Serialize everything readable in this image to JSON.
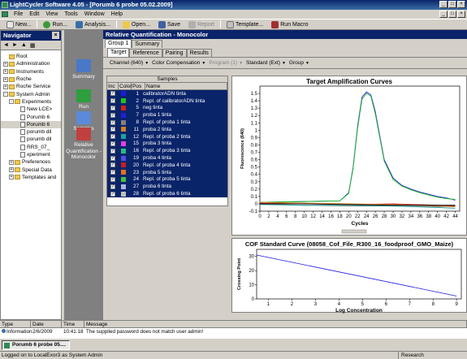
{
  "app": {
    "title": "LightCycler Software 4.05 - [Porumb 6 probe 05.02.2009]"
  },
  "menu": [
    "File",
    "Edit",
    "View",
    "Tools",
    "Window",
    "Help"
  ],
  "toolbar": {
    "new": "New...",
    "run": "Run...",
    "analysis": "Analysis...",
    "open": "Open...",
    "save": "Save",
    "report": "Report",
    "template": "Template...",
    "run_macro": "Run Macro"
  },
  "navigator": {
    "title": "Navigator",
    "items": [
      {
        "label": "Root",
        "level": 0,
        "type": "folder",
        "exp": ""
      },
      {
        "label": "Administration",
        "level": 0,
        "type": "folder",
        "exp": "+"
      },
      {
        "label": "Instruments",
        "level": 0,
        "type": "folder",
        "exp": "+"
      },
      {
        "label": "Roche",
        "level": 0,
        "type": "folder",
        "exp": "+"
      },
      {
        "label": "Roche Service",
        "level": 0,
        "type": "folder",
        "exp": "+"
      },
      {
        "label": "System Admin",
        "level": 0,
        "type": "folder",
        "exp": "-"
      },
      {
        "label": "Experiments",
        "level": 1,
        "type": "folder",
        "exp": "-"
      },
      {
        "label": "New LCE>",
        "level": 2,
        "type": "file",
        "exp": ""
      },
      {
        "label": "Porumb 6",
        "level": 2,
        "type": "file",
        "exp": ""
      },
      {
        "label": "Porumb 6",
        "level": 2,
        "type": "file",
        "exp": "",
        "selected": true
      },
      {
        "label": "porumb dil",
        "level": 2,
        "type": "file",
        "exp": ""
      },
      {
        "label": "porumb dil",
        "level": 2,
        "type": "file",
        "exp": ""
      },
      {
        "label": "RRS_07_",
        "level": 2,
        "type": "file",
        "exp": ""
      },
      {
        "label": "xperiment",
        "level": 2,
        "type": "file",
        "exp": ""
      },
      {
        "label": "Preferences",
        "level": 1,
        "type": "folder",
        "exp": "+"
      },
      {
        "label": "Special Data",
        "level": 1,
        "type": "folder",
        "exp": "+"
      },
      {
        "label": "Templates and",
        "level": 1,
        "type": "folder",
        "exp": "+"
      }
    ]
  },
  "shortcuts": [
    {
      "label": "Summary",
      "lines": [
        "Summary"
      ],
      "color": "#4a78c8"
    },
    {
      "label": "Run",
      "lines": [
        "Run"
      ],
      "color": "#2e9e3e"
    },
    {
      "label": "Samples",
      "lines": [
        "Samples"
      ],
      "color": "#5a8ad8"
    },
    {
      "label": "Relative Quantification - Monocolor",
      "lines": [
        "Relative",
        "Quantification -",
        "Monocolor"
      ],
      "color": "#c04040"
    }
  ],
  "module": {
    "title": "Relative Quantification - Monocolor"
  },
  "tabs1": [
    "Group 1",
    "Summary"
  ],
  "tabs2": [
    "Target",
    "Reference",
    "Pairing",
    "Results"
  ],
  "options": [
    {
      "label": "Channel (640)",
      "disabled": false
    },
    {
      "label": "Color Compensation",
      "disabled": false
    },
    {
      "label": "Program (1)",
      "disabled": true
    },
    {
      "label": "Standard (Ext)",
      "disabled": false
    },
    {
      "label": "Group",
      "disabled": false
    }
  ],
  "samples": {
    "header": "Samples",
    "columns": [
      "Inc",
      "Color",
      "Pos",
      "Name"
    ],
    "rows": [
      {
        "pos": "1",
        "name": "calibratorADN tinta",
        "color": "#1a1ae0"
      },
      {
        "pos": "2",
        "name": "Repl. of calibratorADN tinta",
        "color": "#20c020"
      },
      {
        "pos": "5",
        "name": "neg tinta",
        "color": "#d02020"
      },
      {
        "pos": "7",
        "name": "proba 1 tinta",
        "color": "#2020d0"
      },
      {
        "pos": "8",
        "name": "Repl. of proba 1 tinta",
        "color": "#808080"
      },
      {
        "pos": "11",
        "name": "proba 2 tinta",
        "color": "#d08020"
      },
      {
        "pos": "12",
        "name": "Repl. of proba 2 tinta",
        "color": "#20a0a0"
      },
      {
        "pos": "15",
        "name": "proba 3 tinta",
        "color": "#e040e0"
      },
      {
        "pos": "16",
        "name": "Repl. of proba 3 tinta",
        "color": "#20c080"
      },
      {
        "pos": "19",
        "name": "proba 4 tinta",
        "color": "#5050e0"
      },
      {
        "pos": "20",
        "name": "Repl. of proba 4 tinta",
        "color": "#c02020"
      },
      {
        "pos": "23",
        "name": "proba 5 tinta",
        "color": "#e07020"
      },
      {
        "pos": "24",
        "name": "Repl. of proba 5 tinta",
        "color": "#40c040"
      },
      {
        "pos": "27",
        "name": "proba 6 tinta",
        "color": "#b0b0e0"
      },
      {
        "pos": "28",
        "name": "Repl. of proba 6 tinta",
        "color": "#c0c0c0"
      }
    ]
  },
  "chart_data": [
    {
      "type": "line",
      "title": "Target Amplification Curves",
      "xlabel": "Cycles",
      "ylabel": "Fluorescence (640)",
      "xlim": [
        0,
        45
      ],
      "ylim": [
        -0.1,
        1.6
      ],
      "xticks": [
        0,
        2,
        4,
        6,
        8,
        10,
        12,
        14,
        16,
        18,
        20,
        22,
        24,
        26,
        28,
        30,
        32,
        34,
        36,
        38,
        40,
        42,
        44
      ],
      "yticks": [
        -0.1,
        0,
        0.1,
        0.2,
        0.3,
        0.4,
        0.5,
        0.6,
        0.7,
        0.8,
        0.9,
        1,
        1.1,
        1.2,
        1.3,
        1.4,
        1.5
      ],
      "series": [
        {
          "color": "#1a1ae0",
          "x": [
            0,
            18,
            20,
            21,
            22,
            23,
            24,
            25,
            26,
            28,
            30,
            32,
            34,
            36,
            38,
            40,
            42,
            44
          ],
          "y": [
            0.02,
            0.04,
            0.15,
            0.5,
            1.05,
            1.45,
            1.52,
            1.48,
            1.25,
            0.6,
            0.35,
            0.25,
            0.2,
            0.16,
            0.13,
            0.1,
            0.08,
            0.05
          ]
        },
        {
          "color": "#20c020",
          "x": [
            0,
            18,
            20,
            21,
            22,
            23,
            24,
            25,
            26,
            28,
            30,
            32,
            34,
            36,
            38,
            40,
            42,
            44
          ],
          "y": [
            0.02,
            0.04,
            0.14,
            0.48,
            1.02,
            1.42,
            1.5,
            1.46,
            1.22,
            0.58,
            0.33,
            0.24,
            0.19,
            0.15,
            0.12,
            0.09,
            0.07,
            0.06
          ]
        },
        {
          "color": "#808080",
          "x": [
            0,
            10,
            20,
            30,
            40,
            44
          ],
          "y": [
            0.0,
            -0.02,
            -0.03,
            -0.03,
            -0.04,
            -0.03
          ]
        },
        {
          "color": "#d02020",
          "x": [
            0,
            10,
            20,
            30,
            40,
            44
          ],
          "y": [
            0.01,
            0.0,
            -0.01,
            0.0,
            -0.02,
            -0.03
          ]
        },
        {
          "color": "#d08020",
          "x": [
            0,
            10,
            20,
            30,
            40,
            44
          ],
          "y": [
            0.02,
            0.01,
            0.0,
            -0.01,
            -0.03,
            -0.04
          ]
        },
        {
          "color": "#20a0a0",
          "x": [
            0,
            10,
            20,
            30,
            40,
            44
          ],
          "y": [
            -0.01,
            -0.02,
            -0.02,
            -0.03,
            -0.05,
            -0.06
          ]
        },
        {
          "color": "#000000",
          "x": [
            0,
            10,
            20,
            30,
            40,
            44
          ],
          "y": [
            0.0,
            0.0,
            -0.01,
            -0.02,
            -0.02,
            -0.02
          ]
        }
      ]
    },
    {
      "type": "line",
      "title": "COF Standard Curve (08058_Cof_File_R300_16_foodproof_GMO_Maize)",
      "xlabel": "Log Concentration",
      "ylabel": "Crossing Point",
      "xlim": [
        0.5,
        9.2
      ],
      "ylim": [
        0,
        35
      ],
      "xticks": [
        1,
        2,
        3,
        4,
        5,
        6,
        7,
        8,
        9
      ],
      "yticks": [
        0,
        10,
        20,
        30
      ],
      "series": [
        {
          "color": "#1a1ae0",
          "x": [
            0.5,
            9
          ],
          "y": [
            31,
            2
          ]
        }
      ]
    }
  ],
  "messages": {
    "columns": [
      "Type",
      "Date",
      "Time",
      "Message"
    ],
    "rows": [
      {
        "type": "Information",
        "date": "2/6/2009",
        "time": "10:41:18",
        "message": "The supplied password does not match user admin!"
      }
    ]
  },
  "taskbar": {
    "item": "Porumb 6 probe 05...."
  },
  "status": {
    "left": "Logged on to LocalExor3 as System Admin",
    "right": "Research"
  }
}
